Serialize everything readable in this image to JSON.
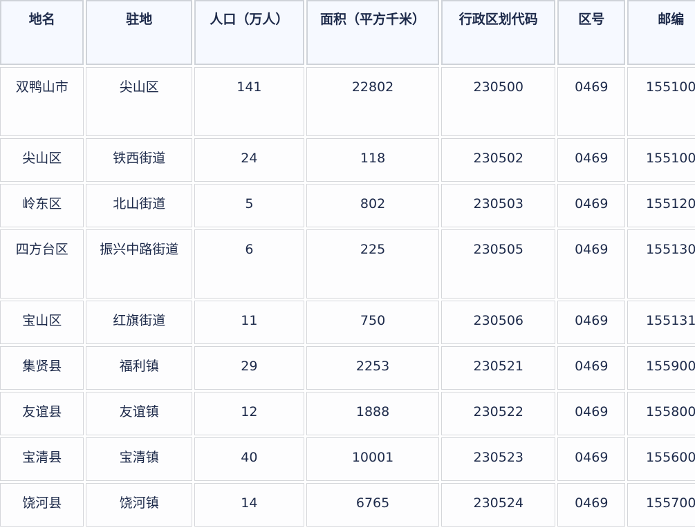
{
  "headers": [
    "地名",
    "驻地",
    "人口（万人）",
    "面积（平方千米）",
    "行政区划代码",
    "区号",
    "邮编"
  ],
  "rows": [
    [
      "双鸭山市",
      "尖山区",
      "141",
      "22802",
      "230500",
      "0469",
      "155100"
    ],
    [
      "尖山区",
      "铁西街道",
      "24",
      "118",
      "230502",
      "0469",
      "155100"
    ],
    [
      "岭东区",
      "北山街道",
      "5",
      "802",
      "230503",
      "0469",
      "155120"
    ],
    [
      "四方台区",
      "振兴中路街道",
      "6",
      "225",
      "230505",
      "0469",
      "155130"
    ],
    [
      "宝山区",
      "红旗街道",
      "11",
      "750",
      "230506",
      "0469",
      "155131"
    ],
    [
      "集贤县",
      "福利镇",
      "29",
      "2253",
      "230521",
      "0469",
      "155900"
    ],
    [
      "友谊县",
      "友谊镇",
      "12",
      "1888",
      "230522",
      "0469",
      "155800"
    ],
    [
      "宝清县",
      "宝清镇",
      "40",
      "10001",
      "230523",
      "0469",
      "155600"
    ],
    [
      "饶河县",
      "饶河镇",
      "14",
      "6765",
      "230524",
      "0469",
      "155700"
    ]
  ]
}
